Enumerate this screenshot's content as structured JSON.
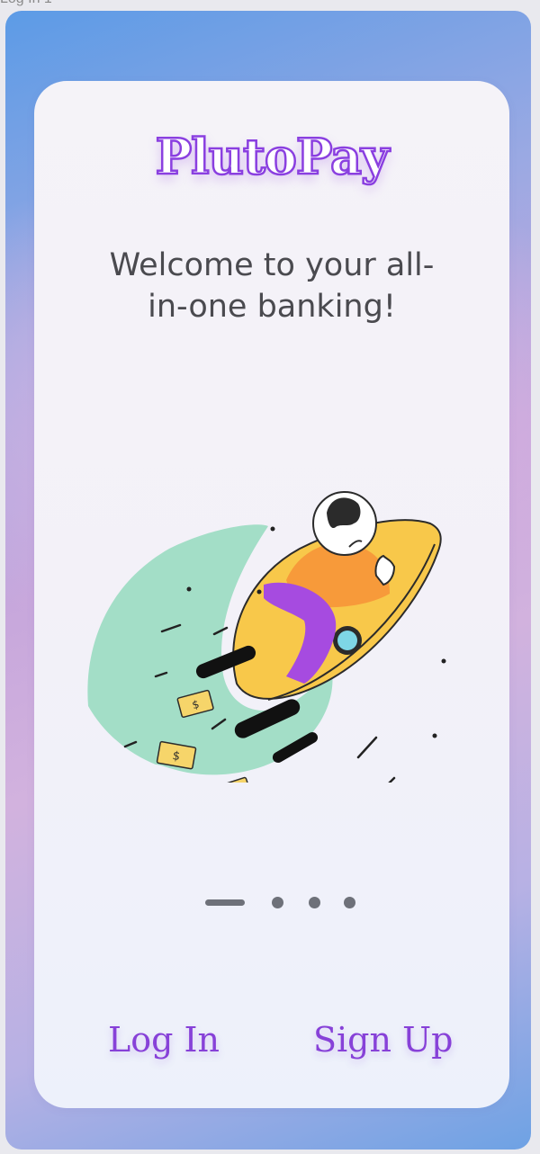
{
  "window": {
    "title": "Log In 1"
  },
  "app": {
    "logo": "PlutoPay",
    "welcome": "Welcome to your all-in-one banking!"
  },
  "onboarding": {
    "active_page": 1,
    "page_count": 4
  },
  "actions": {
    "login_label": "Log In",
    "signup_label": "Sign Up"
  },
  "colors": {
    "accent": "#8741D8",
    "rocket": "#F8C84A",
    "shirt": "#F79A3A",
    "pants": "#A64BE0",
    "trail": "#9ADBC1",
    "money": "#F6D56A"
  }
}
